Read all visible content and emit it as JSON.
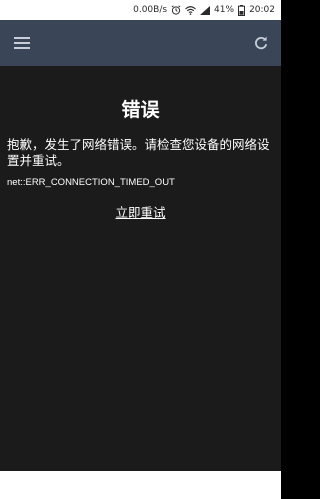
{
  "status_bar": {
    "network_speed": "0.00B/s",
    "battery_percent": "41%",
    "time": "20:02",
    "icons": [
      "alarm-icon",
      "wifi-icon",
      "signal-icon",
      "battery-icon"
    ]
  },
  "app_bar": {
    "menu_icon": "hamburger-menu-icon",
    "refresh_icon": "refresh-icon",
    "background_color": "#3a4658"
  },
  "error": {
    "title": "错误",
    "description": "抱歉，发生了网络错误。请检查您设备的网络设置并重试。",
    "code": "net::ERR_CONNECTION_TIMED_OUT",
    "retry_label": "立即重试"
  },
  "colors": {
    "content_background": "#1b1b1b",
    "text": "#ffffff"
  }
}
